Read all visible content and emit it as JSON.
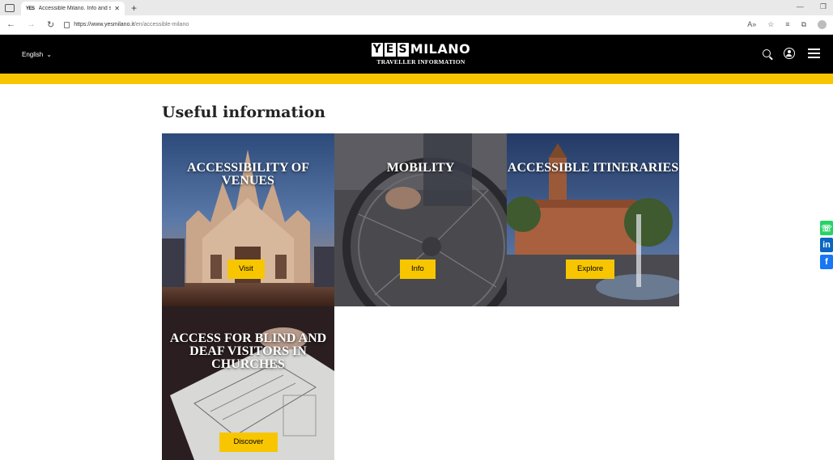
{
  "browser": {
    "tab_title": "Accessible Milano. Info and serv",
    "tab_favicon": "YES",
    "url_host": "https://www.yesmilano.it",
    "url_path": "/en/accessible-milano"
  },
  "header": {
    "language": "English",
    "logo_text": "YESMILANO",
    "logo_subtitle": "TRAVELLER INFORMATION"
  },
  "page": {
    "heading": "Useful information"
  },
  "cards": [
    {
      "title": "Accessibility of venues",
      "button": "Visit"
    },
    {
      "title": "Mobility",
      "button": "Info"
    },
    {
      "title": "Accessible itineraries",
      "button": "Explore"
    },
    {
      "title": "Access for blind and deaf visitors in churches",
      "button": "Discover"
    }
  ],
  "social": {
    "whatsapp": "whatsapp-icon",
    "linkedin": "in",
    "facebook": "f"
  },
  "colors": {
    "brand_yellow": "#f7c600",
    "header_black": "#000000"
  }
}
